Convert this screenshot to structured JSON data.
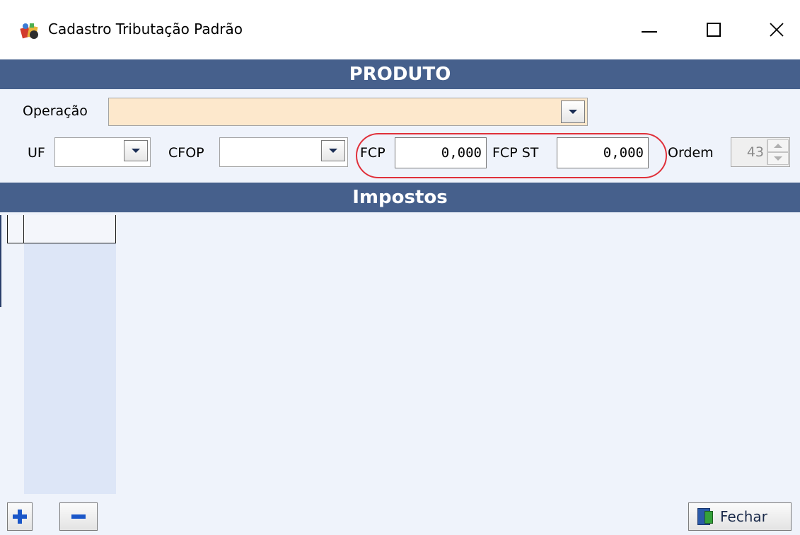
{
  "window": {
    "title": "Cadastro Tributação Padrão",
    "app_icon": "colorful-app-icon",
    "controls": [
      "minimize-icon",
      "maximize-icon",
      "close-icon"
    ]
  },
  "sections": {
    "produto": "PRODUTO",
    "impostos": "Impostos"
  },
  "form": {
    "operacao_label": "Operação",
    "operacao_value": "",
    "uf_label": "UF",
    "uf_value": "",
    "cfop_label": "CFOP",
    "cfop_value": "",
    "fcp_label": "FCP",
    "fcp_value": "0,000",
    "fcp_st_label": "FCP ST",
    "fcp_st_value": "0,000",
    "ordem_label": "Ordem",
    "ordem_value": "43"
  },
  "toolbar": {
    "add_icon": "plus-icon",
    "remove_icon": "minus-icon",
    "close_label": "Fechar",
    "close_icon": "exit-door-icon"
  },
  "colors": {
    "section_bar": "#46608c",
    "panel_bg": "#eff3fb",
    "operacao_bg": "#fde8cc",
    "highlight": "#e0303a",
    "icon_blue": "#1a56c8"
  }
}
